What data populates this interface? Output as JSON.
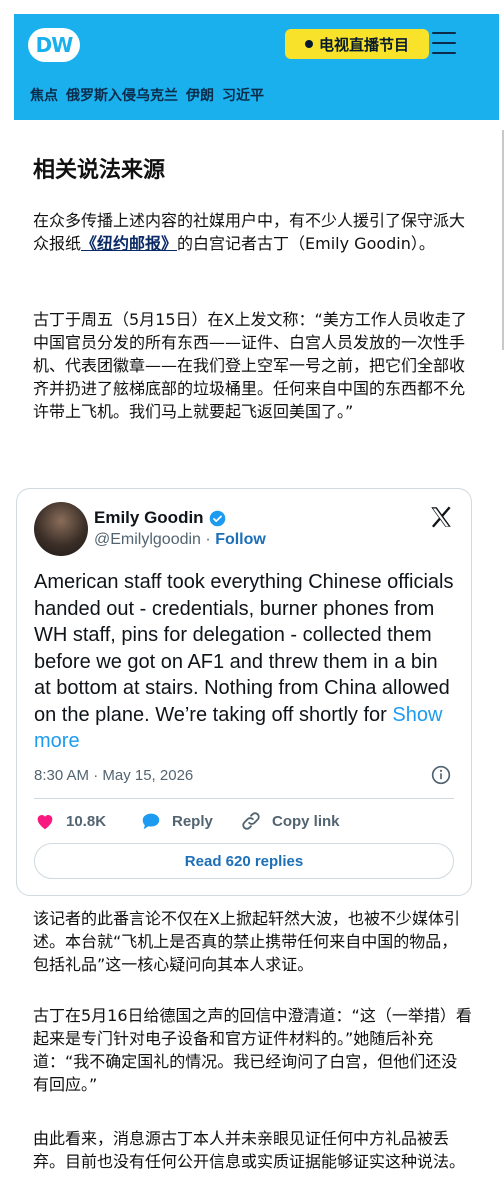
{
  "header": {
    "logo": "DW",
    "live_label": "电视直播节目",
    "nav": {
      "focus": "焦点",
      "items": [
        "俄罗斯入侵乌克兰",
        "伊朗",
        "习近平"
      ]
    }
  },
  "article": {
    "heading": "相关说法来源",
    "p1_a": "在众多传播上述内容的社媒用户中，有不少人援引了保守派大众报纸",
    "p1_link": "《纽约邮报》",
    "p1_b": "的白宫记者古丁（Emily Goodin）。",
    "p2": "古丁于周五（5月15日）在X上发文称：“美方工作人员收走了中国官员分发的所有东西——证件、白宫人员发放的一次性手机、代表团徽章——在我们登上空军一号之前，把它们全部收齐并扔进了舷梯底部的垃圾桶里。任何来自中国的东西都不允许带上飞机。我们马上就要起飞返回美国了。”",
    "p3": "该记者的此番言论不仅在X上掀起轩然大波，也被不少媒体引述。本台就“飞机上是否真的禁止携带任何来自中国的物品，包括礼品”这一核心疑问向其本人求证。",
    "p4": "古丁在5月16日给德国之声的回信中澄清道：“这（一举措）看起来是专门针对电子设备和官方证件材料的。”她随后补充道：“我不确定国礼的情况。我已经询问了白宫，但他们还没有回应。”",
    "p5": "由此看来，消息源古丁本人并未亲眼见证任何中方礼品被丢弃。目前也没有任何公开信息或实质证据能够证实这种说法。"
  },
  "tweet": {
    "name": "Emily Goodin",
    "handle": "@Emilylgoodin",
    "separator": "·",
    "follow": "Follow",
    "text": "American staff took everything Chinese officials handed out - credentials, burner phones from WH staff, pins for delegation - collected them before we got on AF1 and threw them in a bin at bottom at stairs. Nothing from China allowed on the plane. We’re taking off shortly for ",
    "show_more": "Show more",
    "timestamp": "8:30 AM · May 15, 2026",
    "likes": "10.8K",
    "reply": "Reply",
    "copy_link": "Copy link",
    "read_replies": "Read 620 replies"
  },
  "colors": {
    "header_bg": "#1ab0ee",
    "live_bg": "#f8e22a",
    "link": "#1d9bf0",
    "heart": "#f91880"
  },
  "icons": [
    "menu-icon",
    "verified-badge-icon",
    "x-logo-icon",
    "info-icon",
    "heart-icon",
    "reply-bubble-icon",
    "link-icon"
  ]
}
